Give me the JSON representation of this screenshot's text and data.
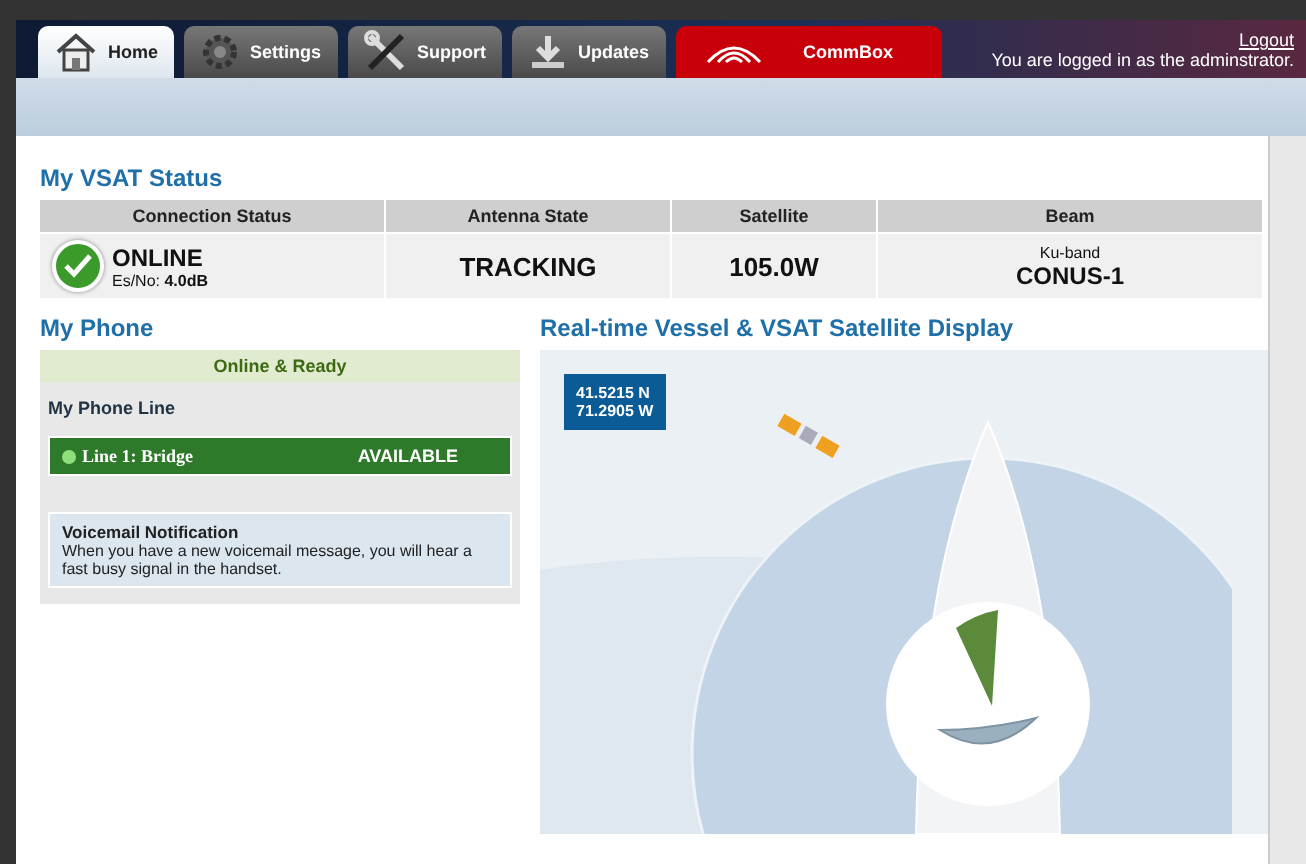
{
  "tabs": [
    {
      "label": "Home",
      "kind": "standard",
      "selected": true
    },
    {
      "label": "Settings",
      "kind": "standard",
      "selected": false
    },
    {
      "label": "Support",
      "kind": "standard",
      "selected": false
    },
    {
      "label": "Updates",
      "kind": "standard",
      "selected": false
    },
    {
      "label": "CommBox",
      "kind": "highlight",
      "selected": false
    }
  ],
  "account": {
    "logout": "Logout",
    "message": "You are logged in as the adminstrator."
  },
  "vsat_status": {
    "title": "My VSAT Status",
    "columns": [
      "Connection Status",
      "Antenna State",
      "Satellite",
      "Beam"
    ],
    "connection": {
      "state": "ONLINE",
      "esno_label": "Es/No:",
      "esno_value": "4.0dB",
      "ok": true
    },
    "antenna_state": "TRACKING",
    "satellite": "105.0W",
    "beam_band": "Ku-band",
    "beam": "CONUS-1"
  },
  "phone": {
    "title": "My Phone",
    "status": "Online & Ready",
    "line_title": "My Phone Line",
    "lines": [
      {
        "name": "Line 1: Bridge",
        "status": "AVAILABLE",
        "available": true
      }
    ],
    "notice_title": "Voicemail Notification",
    "notice_text": "When you have a new voicemail message, you will hear a fast busy signal in the handset."
  },
  "display": {
    "title": "Real-time Vessel & VSAT Satellite Display",
    "latitude": "41.5215 N",
    "longitude": "71.2905 W"
  }
}
